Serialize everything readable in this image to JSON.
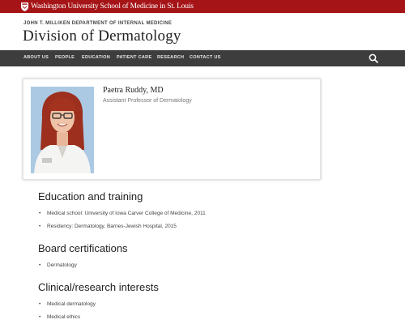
{
  "top_bar": {
    "logo_text": "Washington University School of Medicine in St. Louis",
    "color": "#a51417"
  },
  "header": {
    "department": "JOHN T. MILLIKEN DEPARTMENT OF INTERNAL MEDICINE",
    "division": "Division of Dermatology"
  },
  "nav": {
    "items": [
      {
        "label": "ABOUT US"
      },
      {
        "label": "PEOPLE"
      },
      {
        "label": "EDUCATION"
      },
      {
        "label": "PATIENT CARE"
      },
      {
        "label": "RESEARCH"
      },
      {
        "label": "CONTACT US"
      }
    ],
    "search_icon": "search-icon"
  },
  "profile": {
    "name": "Paetra Ruddy, MD",
    "title": "Assistant Professor of Dermatology"
  },
  "sections": [
    {
      "heading": "Education and training",
      "items": [
        "Medical school: University of Iowa Carver College of Medicine, 2011",
        "Residency: Dermatology, Barnes-Jewish Hospital, 2015"
      ]
    },
    {
      "heading": "Board certifications",
      "items": [
        "Dermatology"
      ]
    },
    {
      "heading": "Clinical/research interests",
      "items": [
        "Medical dermatology",
        "Medical ethics"
      ]
    }
  ]
}
